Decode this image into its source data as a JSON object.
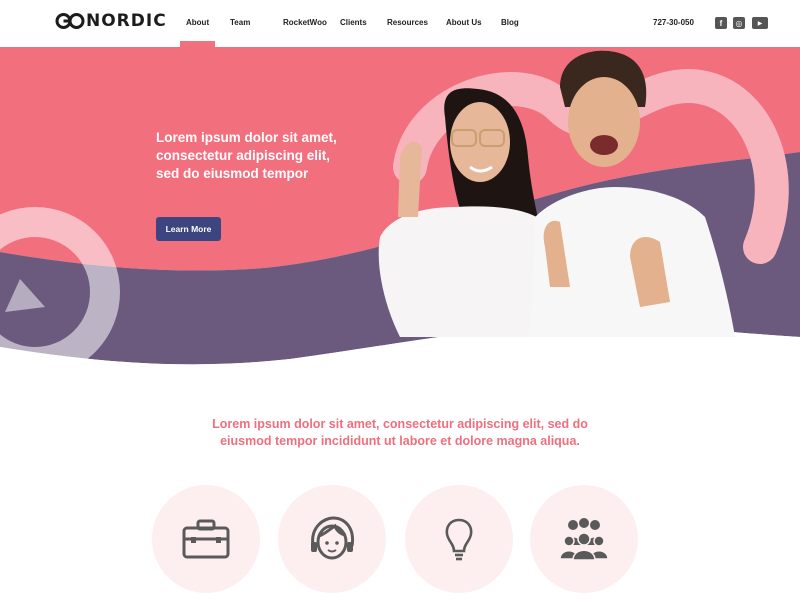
{
  "brand": {
    "logo_text": "NORDIC",
    "logo_mark": "go-infinity-logo-mark"
  },
  "nav": {
    "items": [
      {
        "label": "About",
        "active": true
      },
      {
        "label": "Team"
      },
      {
        "label": "RocketWoo"
      },
      {
        "label": "Clients"
      },
      {
        "label": "Resources"
      },
      {
        "label": "About Us"
      },
      {
        "label": "Blog"
      }
    ]
  },
  "contact": {
    "phone": "727-30-050"
  },
  "social": [
    {
      "icon": "facebook-icon",
      "glyph": "f"
    },
    {
      "icon": "instagram-icon",
      "glyph": "◎"
    },
    {
      "icon": "youtube-icon",
      "glyph": "▶"
    }
  ],
  "hero": {
    "headline_lines": [
      "Lorem ipsum dolor sit amet,",
      "consectetur adipiscing elit,",
      "sed do eiusmod tempor"
    ],
    "cta_label": "Learn More"
  },
  "intro": {
    "lines": [
      "Lorem ipsum dolor sit amet, consectetur adipiscing elit, sed do",
      "eiusmod tempor incididunt ut labore et dolore magna aliqua."
    ]
  },
  "features": [
    {
      "icon": "briefcase-icon"
    },
    {
      "icon": "headset-support-icon"
    },
    {
      "icon": "lightbulb-icon"
    },
    {
      "icon": "team-group-icon"
    }
  ],
  "colors": {
    "accent": "#f0727f",
    "hero_pink": "#f26f7e",
    "hero_purple": "#6b5a7e",
    "button": "#3d4580",
    "feature_bg": "#fdeef0"
  }
}
